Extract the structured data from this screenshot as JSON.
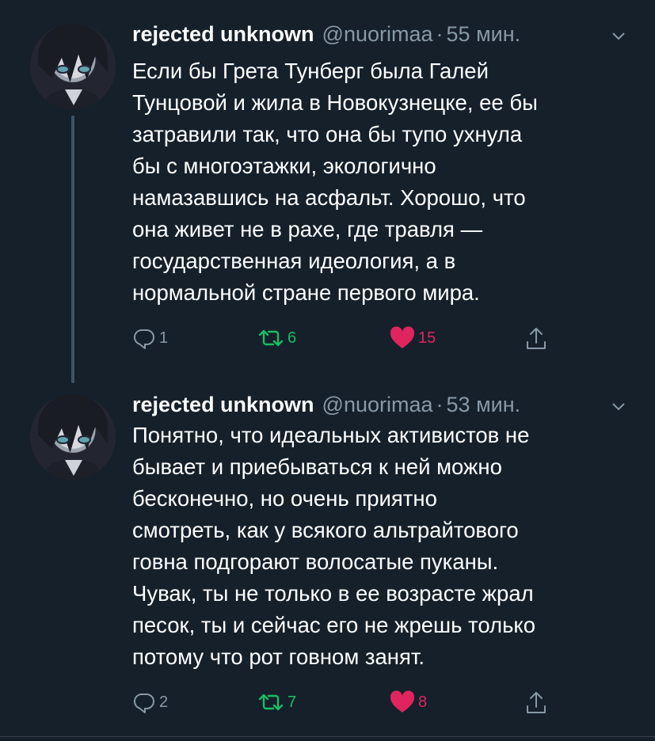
{
  "tweets": [
    {
      "name": "rejected unknown",
      "handle": "@nuorimaa",
      "dot": "·",
      "time": "55 мин.",
      "text": "Если бы Грета Тунберг была Галей\nТунцовой и жила в Новокузнецке, ее бы\nзатравили так, что она бы тупо ухнула\nбы с многоэтажки, экологично\nнамазавшись на асфальт. Хорошо, что\nона живет не в рахе, где травля —\nгосударственная идеология, а в\nнормальной стране первого мира.",
      "replies": "1",
      "retweets": "6",
      "likes": "15"
    },
    {
      "name": "rejected unknown",
      "handle": "@nuorimaa",
      "dot": "·",
      "time": "53 мин.",
      "text": "Понятно, что идеальных активистов не\nбывает и приебываться к ней можно\nбесконечно, но очень приятно\nсмотреть, как у всякого альтрайтового\nговна подгорают волосатые пуканы.\nЧувак, ты не только в ее возрасте жрал\nпесок, ты и сейчас его не жрешь только\nпотому что рот говном занят.",
      "replies": "2",
      "retweets": "7",
      "likes": "8"
    }
  ],
  "colors": {
    "background": "#15202b",
    "secondary_text": "#8899a6",
    "retweet_active": "#17bf63",
    "like_active": "#e0245e"
  },
  "icons": [
    "reply-icon",
    "retweet-icon",
    "heart-icon",
    "share-icon",
    "chevron-down-icon"
  ]
}
